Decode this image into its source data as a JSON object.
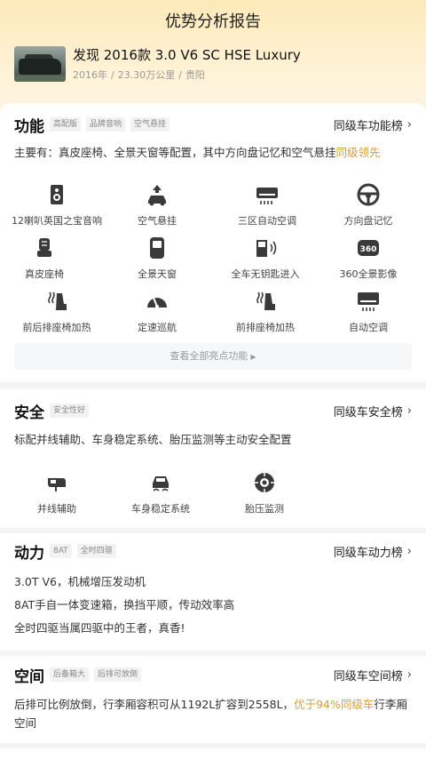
{
  "page_title": "优势分析报告",
  "car": {
    "name": "发现 2016款 3.0 V6 SC HSE Luxury",
    "year": "2016年",
    "mileage": "23.30万公里",
    "city": "贵阳",
    "sep": "/"
  },
  "function": {
    "title": "功能",
    "tags": [
      "高配版",
      "品牌音响",
      "空气悬挂"
    ],
    "rank_label": "同级车功能榜",
    "summary_text": "主要有：真皮座椅、全景天窗等配置，其中方向盘记忆和空气悬挂",
    "summary_highlight": "同级领先",
    "features": [
      {
        "label": "12喇叭英国之宝音响",
        "icon": "speaker-icon"
      },
      {
        "label": "空气悬挂",
        "icon": "air-suspension-icon"
      },
      {
        "label": "三区自动空调",
        "icon": "climate-control-icon"
      },
      {
        "label": "方向盘记忆",
        "icon": "steering-wheel-icon"
      },
      {
        "label": "真皮座椅",
        "icon": "leather-seat-icon"
      },
      {
        "label": "全景天窗",
        "icon": "panoramic-sunroof-icon"
      },
      {
        "label": "全车无钥匙进入",
        "icon": "keyless-entry-icon"
      },
      {
        "label": "360全景影像",
        "icon": "camera-360-icon"
      },
      {
        "label": "前后排座椅加热",
        "icon": "seat-heating-icon"
      },
      {
        "label": "定速巡航",
        "icon": "cruise-control-icon"
      },
      {
        "label": "前排座椅加热",
        "icon": "front-seat-heating-icon"
      },
      {
        "label": "自动空调",
        "icon": "auto-ac-icon"
      }
    ],
    "more_label": "查看全部亮点功能",
    "icon_color": "#3a3a3a",
    "accent_color": "#d4a03c"
  },
  "safety": {
    "title": "安全",
    "tags": [
      "安全性好"
    ],
    "rank_label": "同级车安全榜",
    "summary": "标配并线辅助、车身稳定系统、胎压监测等主动安全配置",
    "features": [
      {
        "label": "并线辅助",
        "icon": "lane-assist-icon"
      },
      {
        "label": "车身稳定系统",
        "icon": "stability-control-icon"
      },
      {
        "label": "胎压监测",
        "icon": "tire-pressure-icon"
      }
    ]
  },
  "power": {
    "title": "动力",
    "tags": [
      "8AT",
      "全时四驱"
    ],
    "rank_label": "同级车动力榜",
    "lines": [
      "3.0T V6，机械增压发动机",
      "8AT手自一体变速箱，换挡平顺，传动效率高",
      "全时四驱当属四驱中的王者，真香!"
    ]
  },
  "space": {
    "title": "空间",
    "tags": [
      "后备箱大",
      "后排可放倒"
    ],
    "rank_label": "同级车空间榜",
    "summary_text": "后排可比例放倒，行李厢容积可从1192L扩容到2558L，",
    "summary_highlight": "优于94%同级车",
    "summary_tail": "行李厢空间"
  }
}
